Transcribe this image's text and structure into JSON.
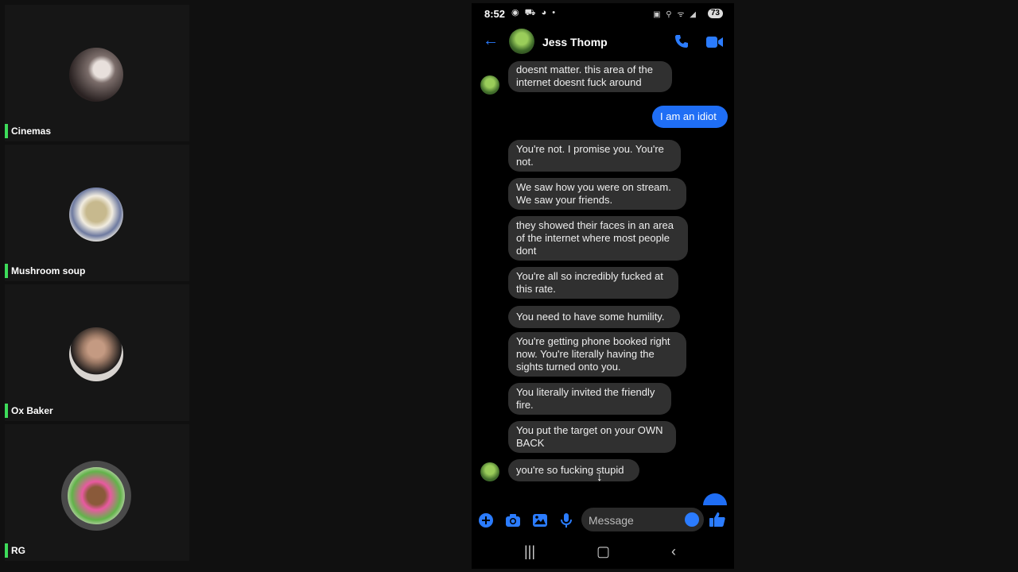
{
  "participants": [
    {
      "name": "Cinemas"
    },
    {
      "name": "Mushroom soup"
    },
    {
      "name": "Ox Baker"
    },
    {
      "name": "RG"
    }
  ],
  "phone": {
    "status": {
      "time": "8:52",
      "left_icons": "◉ ⛟ ◕ •",
      "right_icons": "▣ ⚲ ᯤ ◢",
      "battery": "73"
    },
    "header": {
      "contact_name": "Jess Thomp"
    },
    "messages": [
      {
        "text": "doesnt matter.  this area of the internet doesnt fuck around",
        "direction": "in"
      },
      {
        "text": "I am an idiot",
        "direction": "out"
      },
      {
        "text": "You're not. I promise you.  You're not.",
        "direction": "in"
      },
      {
        "text": "We saw how you were on stream.  We saw your friends.",
        "direction": "in"
      },
      {
        "text": "they showed their faces in an area of the internet where most people dont",
        "direction": "in"
      },
      {
        "text": "You're all so incredibly fucked at this rate.",
        "direction": "in"
      },
      {
        "text": "You need to have some humility.",
        "direction": "in"
      },
      {
        "text": "You're getting phone booked right now.  You're literally having the sights turned onto you.",
        "direction": "in"
      },
      {
        "text": "You literally invited the friendly fire.",
        "direction": "in"
      },
      {
        "text": "You put the target on your OWN BACK",
        "direction": "in"
      },
      {
        "text": "you're so fucking stupid",
        "direction": "in"
      }
    ],
    "composer": {
      "placeholder": "Message"
    },
    "colors": {
      "accent": "#2b7cff",
      "outgoing_bubble": "#1f6ef5",
      "incoming_bubble": "#303030",
      "active_speaker": "#3ddc5a"
    }
  }
}
